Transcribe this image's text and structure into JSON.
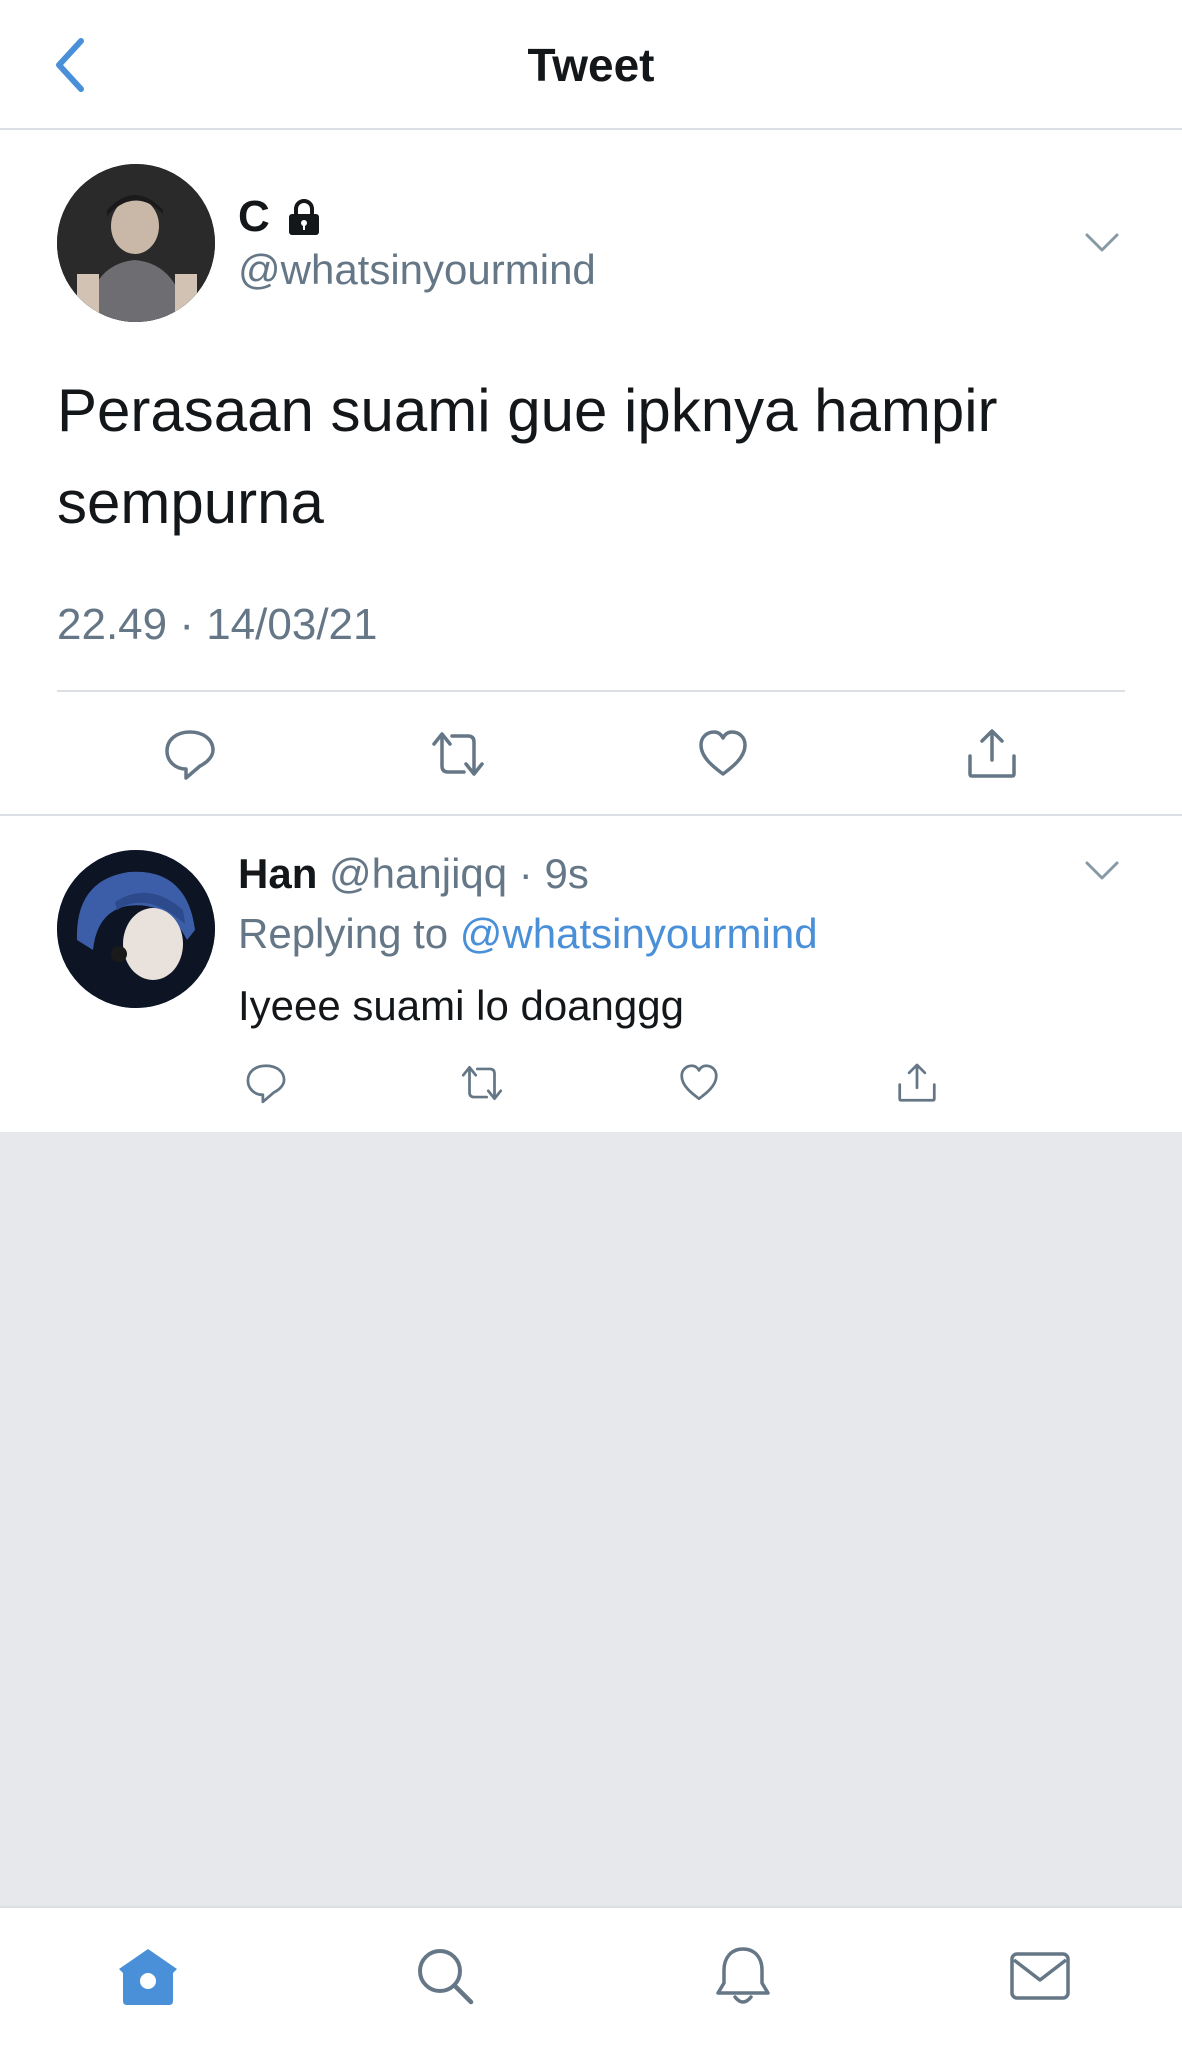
{
  "header": {
    "title": "Tweet",
    "back_icon": "chevron-left-icon"
  },
  "main_tweet": {
    "display_name": "C",
    "protected_icon": "lock-icon",
    "handle": "@whatsinyourmind",
    "text": "Perasaan suami gue ipknya hampir sempurna",
    "timestamp": "22.49 · 14/03/21",
    "actions": [
      "reply-icon",
      "retweet-icon",
      "like-icon",
      "share-icon"
    ]
  },
  "reply": {
    "display_name": "Han",
    "handle": "@hanjiqq",
    "separator": "·",
    "time": "9s",
    "replying_to_label": "Replying to",
    "replying_to_handle": "@whatsinyourmind",
    "text": "Iyeee suami lo doanggg",
    "actions": [
      "reply-icon",
      "retweet-icon",
      "like-icon",
      "share-icon"
    ]
  },
  "tabbar": {
    "items": [
      "home-icon",
      "search-icon",
      "notifications-icon",
      "messages-icon"
    ],
    "active": "home-icon"
  },
  "colors": {
    "accent": "#4a90d9",
    "secondary_text": "#657786",
    "primary_text": "#14171a",
    "background": "#e6e8ec"
  }
}
